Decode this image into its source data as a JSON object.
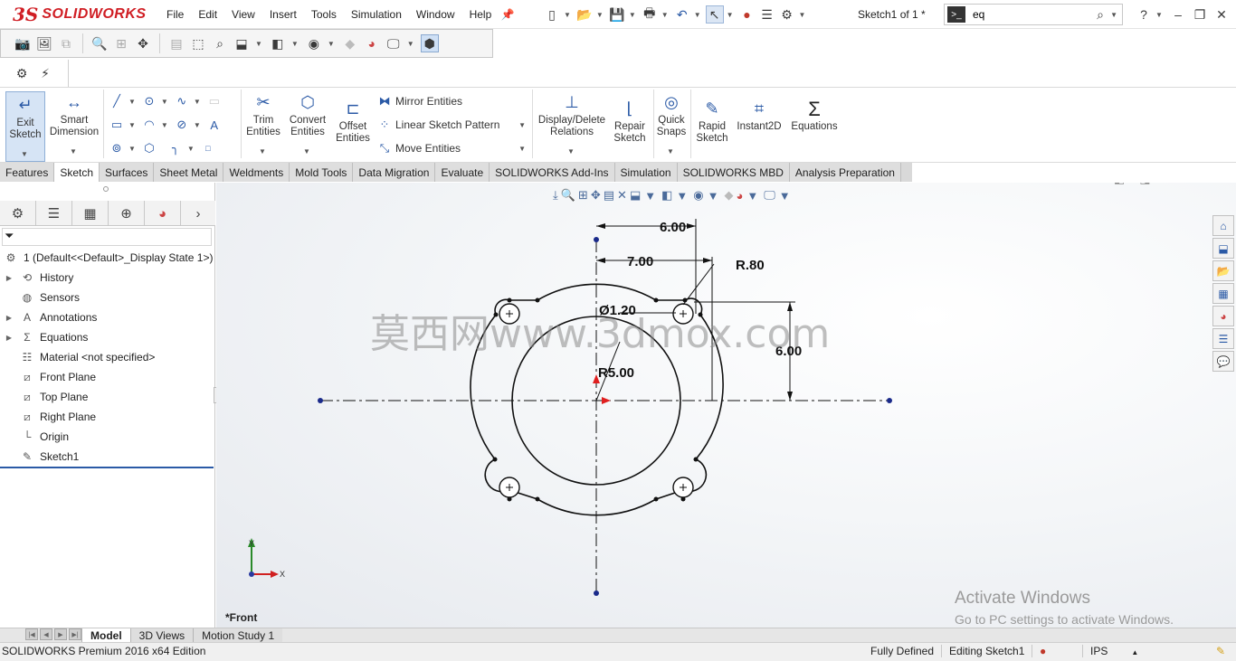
{
  "app": {
    "logo_ds": "3S",
    "logo_text": "SOLIDWORKS",
    "menu": [
      "File",
      "Edit",
      "View",
      "Insert",
      "Tools",
      "Simulation",
      "Window",
      "Help"
    ],
    "doc_title": "Sketch1 of 1 *",
    "search_value": "eq"
  },
  "command_manager": {
    "exit_sketch": "Exit\nSketch",
    "smart_dimension": "Smart\nDimension",
    "trim": "Trim\nEntities",
    "convert": "Convert\nEntities",
    "offset": "Offset\nEntities",
    "mirror": "Mirror Entities",
    "linear_pattern": "Linear Sketch Pattern",
    "move": "Move Entities",
    "display_delete": "Display/Delete\nRelations",
    "repair": "Repair\nSketch",
    "quick_snaps": "Quick\nSnaps",
    "rapid_sketch": "Rapid\nSketch",
    "instant2d": "Instant2D",
    "equations": "Equations"
  },
  "tabs": [
    "Features",
    "Sketch",
    "Surfaces",
    "Sheet Metal",
    "Weldments",
    "Mold Tools",
    "Data Migration",
    "Evaluate",
    "SOLIDWORKS Add-Ins",
    "Simulation",
    "SOLIDWORKS MBD",
    "Analysis Preparation"
  ],
  "active_tab": "Sketch",
  "feature_tree": {
    "root": "1  (Default<<Default>_Display State 1>)",
    "items": [
      {
        "label": "History",
        "expandable": true,
        "icon": "history-icon"
      },
      {
        "label": "Sensors",
        "expandable": false,
        "icon": "sensors-icon"
      },
      {
        "label": "Annotations",
        "expandable": true,
        "icon": "annotations-icon"
      },
      {
        "label": "Equations",
        "expandable": true,
        "icon": "equations-icon"
      },
      {
        "label": "Material <not specified>",
        "expandable": false,
        "icon": "material-icon"
      },
      {
        "label": "Front Plane",
        "expandable": false,
        "icon": "plane-icon"
      },
      {
        "label": "Top Plane",
        "expandable": false,
        "icon": "plane-icon"
      },
      {
        "label": "Right Plane",
        "expandable": false,
        "icon": "plane-icon"
      },
      {
        "label": "Origin",
        "expandable": false,
        "icon": "origin-icon"
      },
      {
        "label": "Sketch1",
        "expandable": false,
        "icon": "sketch-icon"
      }
    ]
  },
  "sketch": {
    "dim_top": "6.00",
    "dim_mid": "7.00",
    "dim_radius_small": "R.80",
    "dim_diameter": "Ø1.20",
    "dim_radius_big": "R5.00",
    "dim_vertical": "6.00",
    "watermark": "莫西网www.3dmox.com",
    "axis_x": "X",
    "axis_y": "Y"
  },
  "view_name": "*Front",
  "activate": {
    "line1": "Activate Windows",
    "line2": "Go to PC settings to activate Windows."
  },
  "bottom_tabs": [
    "Model",
    "3D Views",
    "Motion Study 1"
  ],
  "status": {
    "edition": "SOLIDWORKS Premium 2016 x64 Edition",
    "defined": "Fully Defined",
    "editing": "Editing Sketch1",
    "units": "IPS"
  },
  "colors": {
    "brand_red": "#d01e24",
    "sketch_black": "#111111",
    "endpoint_blue": "#1a2a8a",
    "origin_red": "#e02020"
  }
}
